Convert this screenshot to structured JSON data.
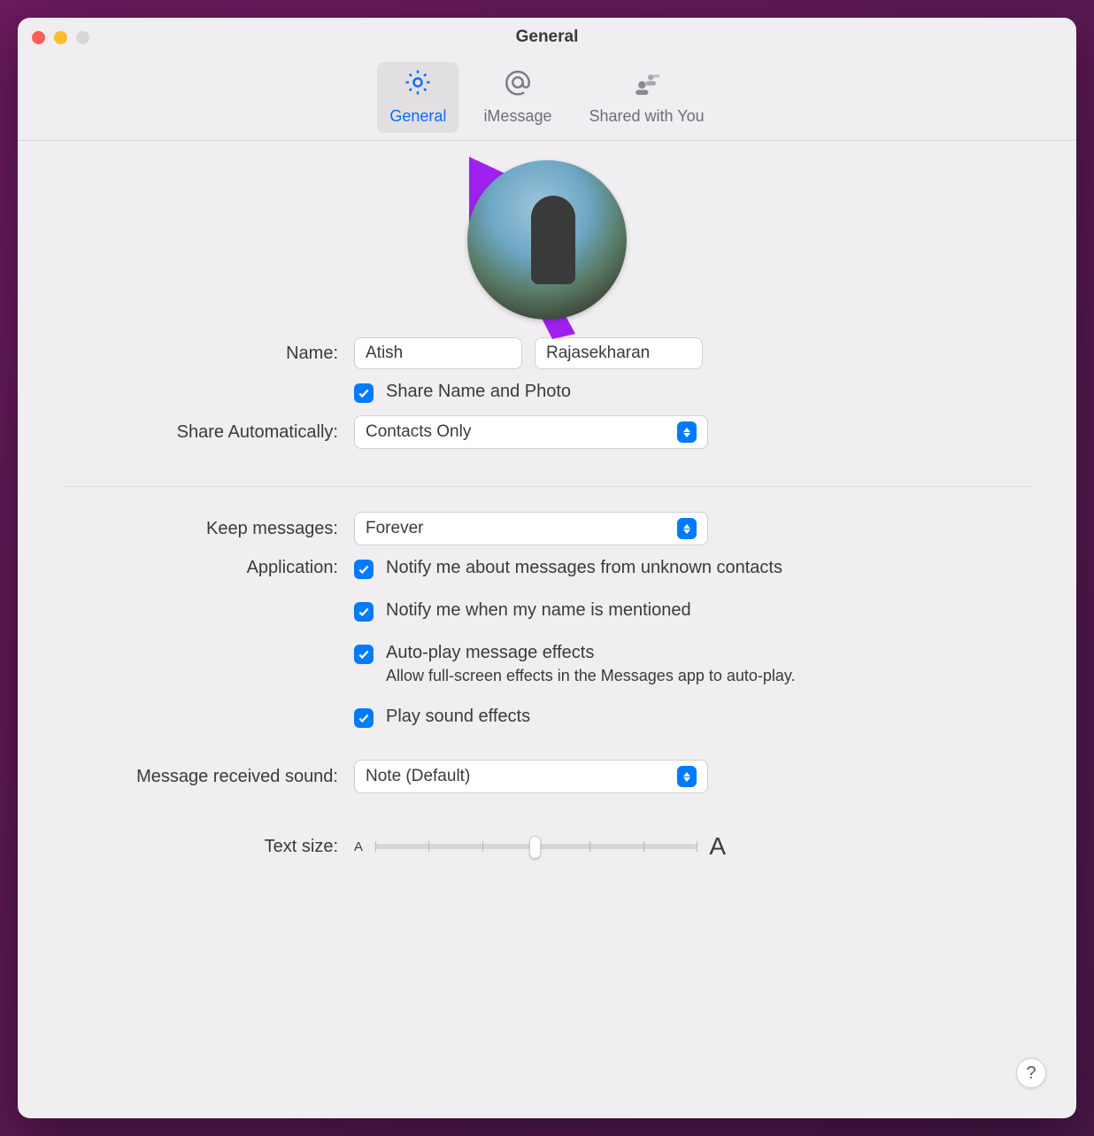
{
  "window_title": "General",
  "tabs": {
    "general": "General",
    "imessage": "iMessage",
    "shared": "Shared with You"
  },
  "labels": {
    "name": "Name:",
    "share_auto": "Share Automatically:",
    "keep_messages": "Keep messages:",
    "application": "Application:",
    "sound": "Message received sound:",
    "text_size": "Text size:"
  },
  "name": {
    "first": "Atish",
    "last": "Rajasekharan"
  },
  "share_name_photo": "Share Name and Photo",
  "share_auto_value": "Contacts Only",
  "keep_messages_value": "Forever",
  "checks": {
    "notify_unknown": "Notify me about messages from unknown contacts",
    "notify_mention": "Notify me when my name is mentioned",
    "autoplay": "Auto-play message effects",
    "autoplay_sub": "Allow full-screen effects in the Messages app to auto-play.",
    "play_sound": "Play sound effects"
  },
  "sound_value": "Note (Default)",
  "help_label": "?",
  "text_size_small": "A",
  "text_size_big": "A"
}
